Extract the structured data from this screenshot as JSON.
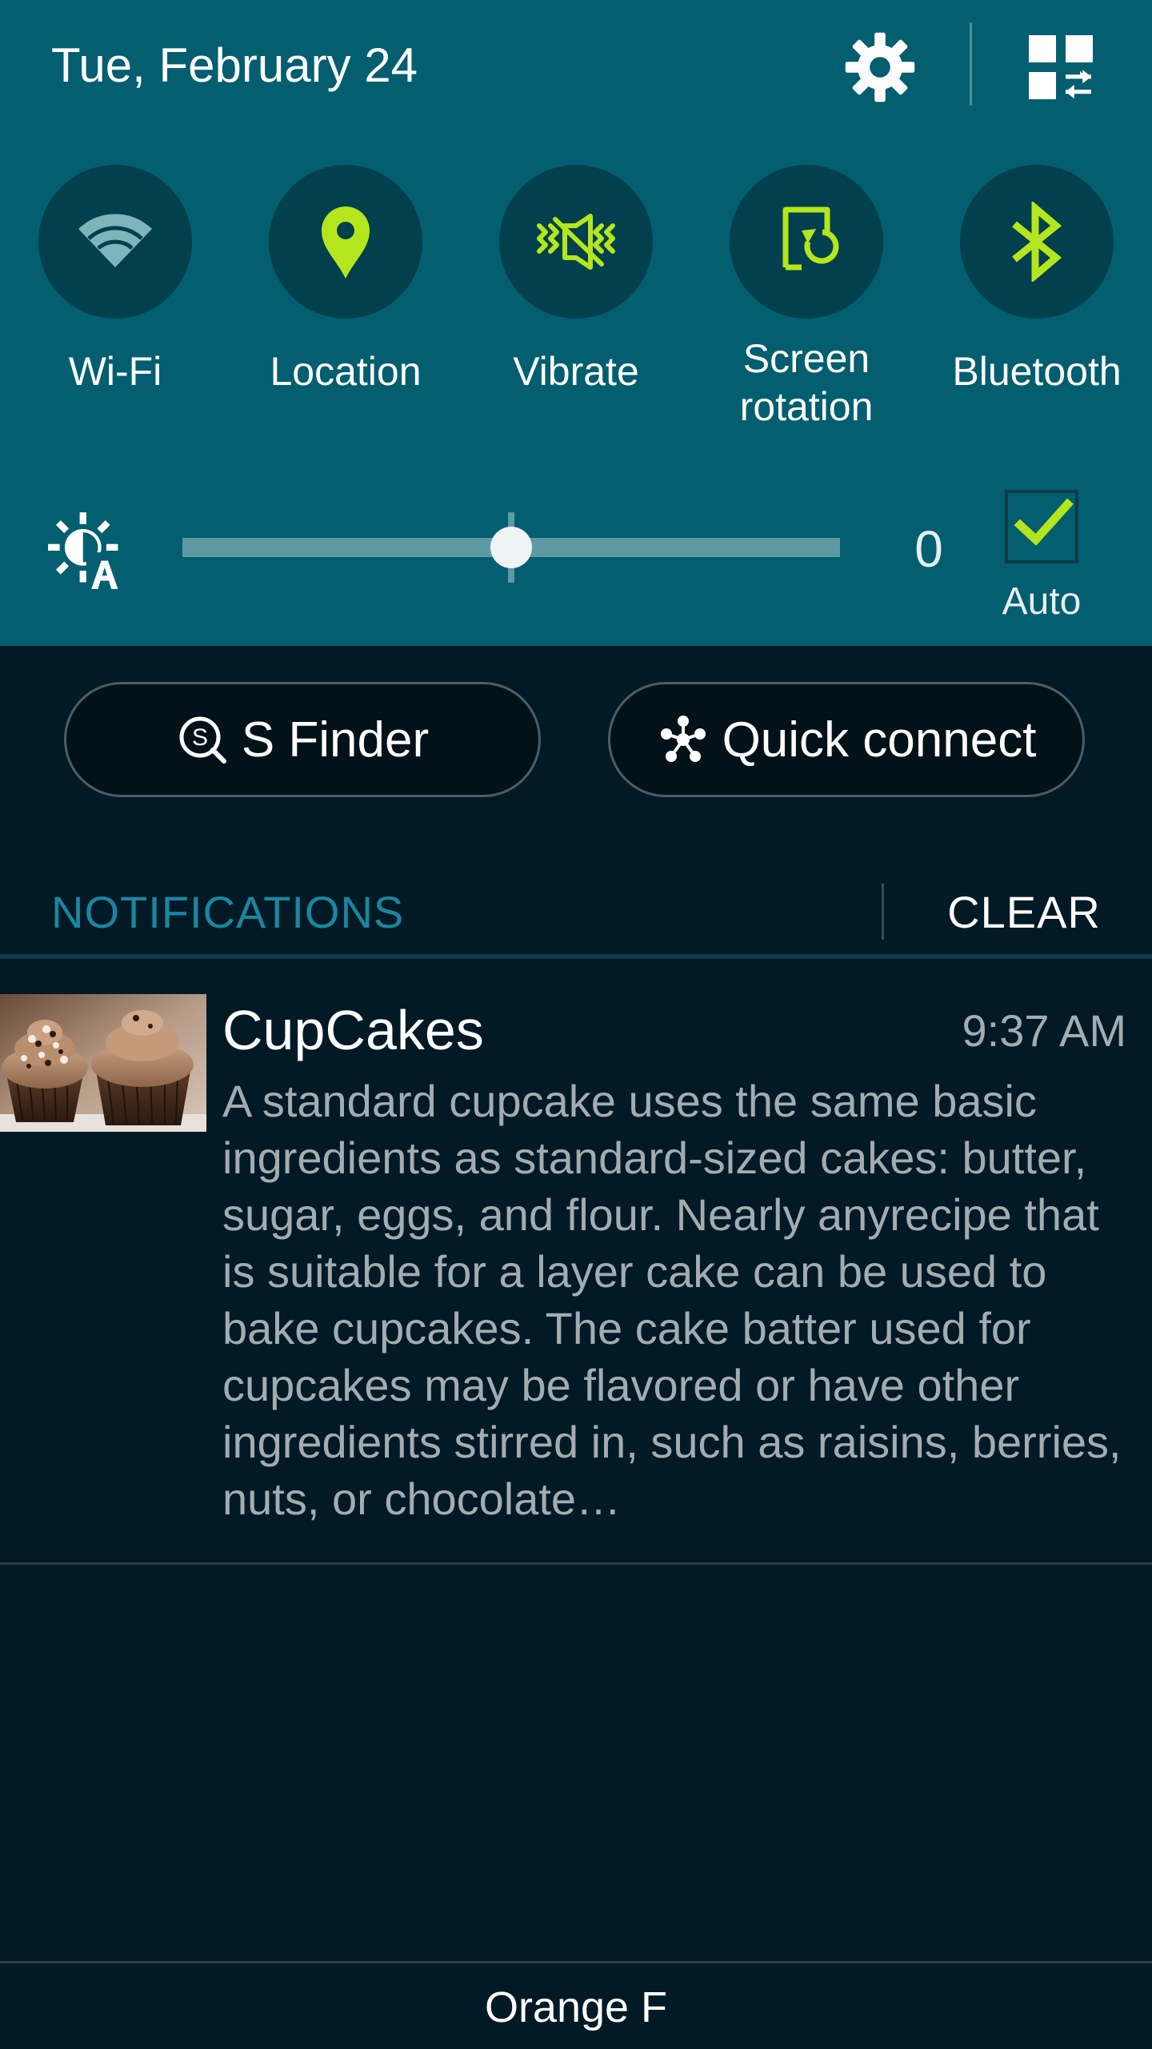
{
  "status": {
    "date": "Tue, February 24"
  },
  "header": {
    "settings_icon": "gear-icon",
    "grid_icon": "grid-edit-icon"
  },
  "quick_settings": [
    {
      "label": "Wi-Fi",
      "icon": "wifi-icon",
      "active": false
    },
    {
      "label": "Location",
      "icon": "location-pin-icon",
      "active": true
    },
    {
      "label": "Vibrate",
      "icon": "vibrate-icon",
      "active": true
    },
    {
      "label": "Screen\nrotation",
      "icon": "screen-rotation-icon",
      "active": true
    },
    {
      "label": "Bluetooth",
      "icon": "bluetooth-icon",
      "active": true
    }
  ],
  "brightness": {
    "icon": "auto-brightness-icon",
    "value": "0",
    "level_fraction": 0.5,
    "auto_label": "Auto",
    "auto_checked": true
  },
  "actions": {
    "s_finder_label": "S Finder",
    "quick_connect_label": "Quick connect"
  },
  "notifications": {
    "title": "NOTIFICATIONS",
    "clear_label": "CLEAR",
    "items": [
      {
        "app": "CupCakes",
        "time": "9:37 AM",
        "body": "A standard cupcake uses the same basic ingredients as standard-sized cakes: butter, sugar, eggs, and flour. Nearly anyrecipe that is suitable for a layer cake can be used to bake cupcakes. The cake batter used for cupcakes may be flavored or have other ingredients stirred in, such as raisins, berries, nuts, or chocolate…"
      }
    ]
  },
  "footer": {
    "carrier": "Orange F"
  },
  "colors": {
    "panel_bg": "#035e70",
    "shade_bg": "#011a25",
    "accent_green": "#b5e61d",
    "accent_blue": "#1b86a0",
    "inactive_icon": "#7fb4bd"
  }
}
